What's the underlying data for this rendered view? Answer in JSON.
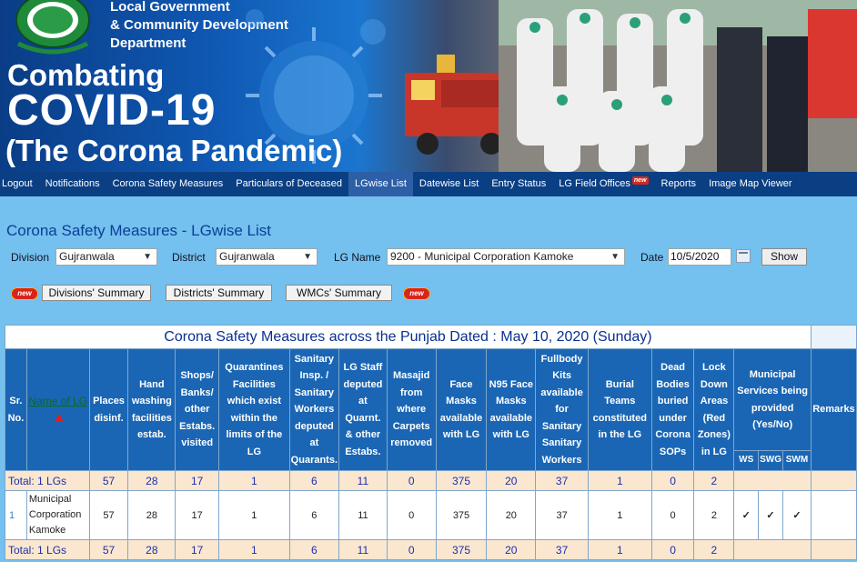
{
  "banner": {
    "dept_line1": "Local Government",
    "dept_line2": "& Community Development",
    "dept_line3": "Department",
    "title_line1": "Combating",
    "title_line2": "COVID-19",
    "title_line3": "(The Corona Pandemic)"
  },
  "nav": {
    "items": [
      {
        "label": "Logout"
      },
      {
        "label": "Notifications"
      },
      {
        "label": "Corona Safety Measures"
      },
      {
        "label": "Particulars of Deceased"
      },
      {
        "label": "LGwise List"
      },
      {
        "label": "Datewise List"
      },
      {
        "label": "Entry Status"
      },
      {
        "label": "LG Field Offices",
        "badge": "new"
      },
      {
        "label": "Reports"
      },
      {
        "label": "Image Map Viewer"
      }
    ]
  },
  "page": {
    "title": "Corona Safety Measures - LGwise List"
  },
  "filters": {
    "division_label": "Division",
    "division_value": "Gujranwala",
    "district_label": "District",
    "district_value": "Gujranwala",
    "lg_label": "LG Name",
    "lg_value": "9200 - Municipal Corporation Kamoke",
    "date_label": "Date",
    "date_value": "10/5/2020",
    "show_label": "Show"
  },
  "summaries": {
    "new_badge": "new",
    "divisions": "Divisions' Summary",
    "districts": "Districts' Summary",
    "wmcs": "WMCs' Summary"
  },
  "table": {
    "caption": "Corona Safety Measures across the Punjab Dated : May 10, 2020 (Sunday)",
    "headers": {
      "sr": "Sr. No.",
      "name": "Name of LG",
      "places": "Places disinf.",
      "hand": "Hand washing facilities estab.",
      "shops": "Shops/ Banks/ other Estabs. visited",
      "quarantines": "Quarantines Facilities which exist within the limits of the LG",
      "sanitary": "Sanitary Insp. / Sanitary Workers deputed at Quarants.",
      "lgstaff": "LG Staff deputed at Quarnt. & other Estabs.",
      "masajid": "Masajid from where Carpets removed",
      "face": "Face Masks available with LG",
      "n95": "N95 Face Masks available with LG",
      "fullbody": "Fullbody Kits available for Sanitary Sanitary Workers",
      "burial": "Burial Teams constituted in the LG",
      "dead": "Dead Bodies buried under Corona SOPs",
      "lockdown": "Lock Down Areas (Red Zones) in LG",
      "municipal": "Municipal Services being provided (Yes/No)",
      "ws": "WS",
      "swg": "SWG",
      "swm": "SWM",
      "remarks": "Remarks"
    },
    "total_top": {
      "label": "Total: 1 LGs",
      "places": "57",
      "hand": "28",
      "shops": "17",
      "quarantines": "1",
      "sanitary": "6",
      "lgstaff": "11",
      "masajid": "0",
      "face": "375",
      "n95": "20",
      "fullbody": "37",
      "burial": "1",
      "dead": "0",
      "lockdown": "2"
    },
    "rows": [
      {
        "sr": "1",
        "name": "Municipal Corporation Kamoke",
        "places": "57",
        "hand": "28",
        "shops": "17",
        "quarantines": "1",
        "sanitary": "6",
        "lgstaff": "11",
        "masajid": "0",
        "face": "375",
        "n95": "20",
        "fullbody": "37",
        "burial": "1",
        "dead": "0",
        "lockdown": "2",
        "ws": "✓",
        "swg": "✓",
        "swm": "✓",
        "remarks": ""
      }
    ],
    "total_bottom": {
      "label": "Total: 1 LGs",
      "places": "57",
      "hand": "28",
      "shops": "17",
      "quarantines": "1",
      "sanitary": "6",
      "lgstaff": "11",
      "masajid": "0",
      "face": "375",
      "n95": "20",
      "fullbody": "37",
      "burial": "1",
      "dead": "0",
      "lockdown": "2"
    }
  },
  "colors": {
    "page_bg": "#74C0EE",
    "nav_bg": "#0b3f83",
    "header_bg": "#1a66b5",
    "total_bg": "#fbe7cf",
    "title_blue": "#0b3f9a"
  }
}
